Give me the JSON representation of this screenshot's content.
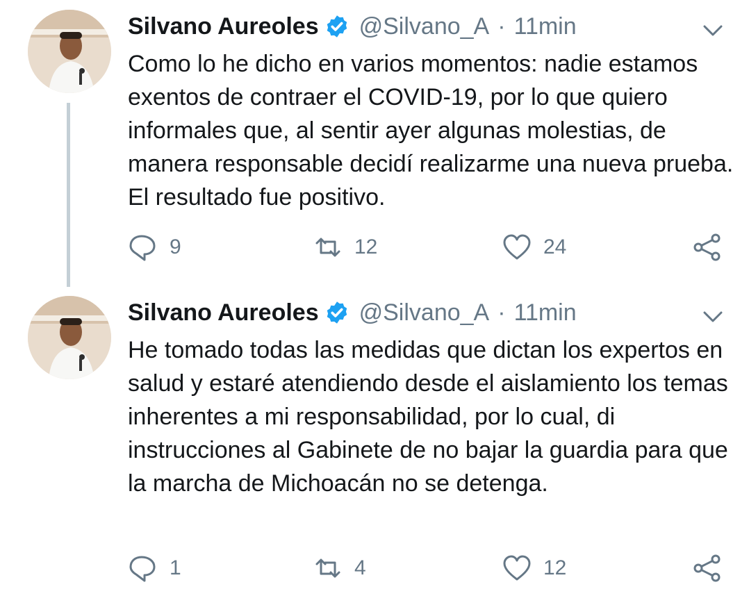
{
  "tweets": [
    {
      "name": "Silvano Aureoles",
      "handle": "@Silvano_A",
      "separator": "·",
      "time": "11min",
      "text": "Como lo he dicho en varios momentos: nadie estamos exentos de contraer el COVID-19, por lo que quiero informales que, al sentir ayer algunas molestias, de manera responsable decidí realizarme una nueva prueba. El resultado fue positivo.",
      "replies": "9",
      "retweets": "12",
      "likes": "24"
    },
    {
      "name": "Silvano Aureoles",
      "handle": "@Silvano_A",
      "separator": "·",
      "time": "11min",
      "text": "He tomado todas las medidas que dictan los expertos en salud y estaré atendiendo desde el aislamiento los temas inherentes a mi responsabilidad, por lo cual, di instrucciones al Gabinete de no bajar la guardia para que la marcha de Michoacán no se detenga.",
      "replies": "1",
      "retweets": "4",
      "likes": "12"
    }
  ],
  "colors": {
    "text": "#14171a",
    "secondary": "#657786",
    "verified": "#1da1f2",
    "thread_line": "#c4cfd6"
  },
  "icons": [
    "verified-badge-icon",
    "chevron-down-icon",
    "reply-icon",
    "retweet-icon",
    "like-icon",
    "share-icon"
  ]
}
